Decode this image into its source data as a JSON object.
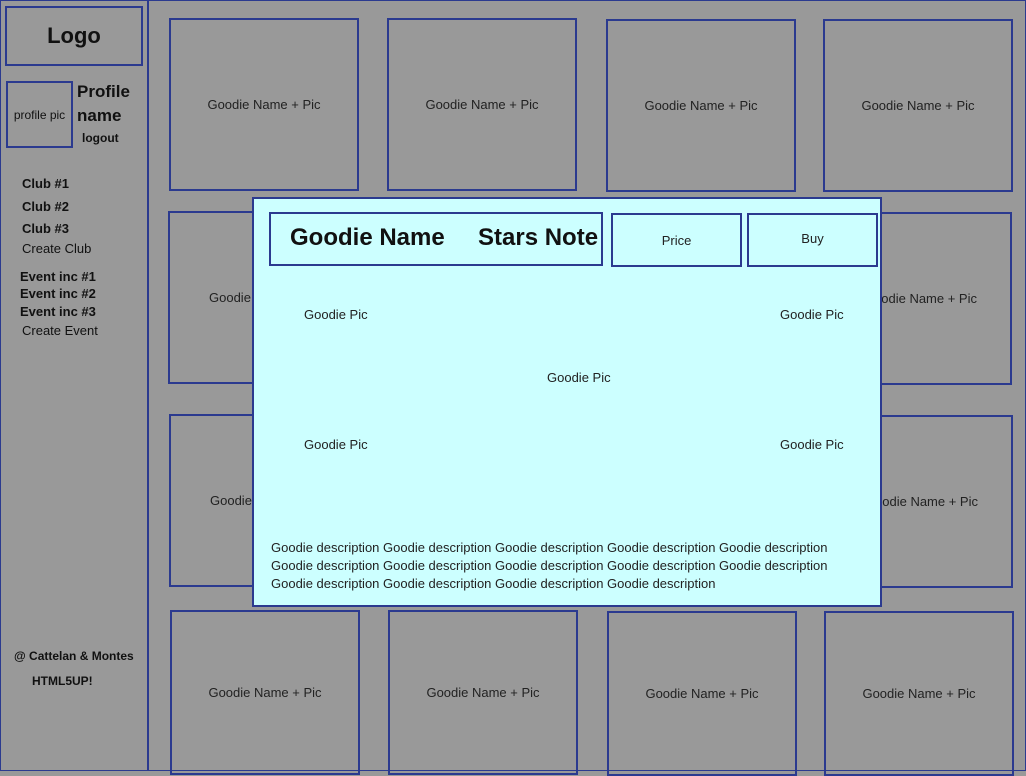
{
  "sidebar": {
    "logo": "Logo",
    "profile_pic": "profile pic",
    "profile_name": "Profile name",
    "logout": "logout",
    "clubs": [
      "Club #1",
      "Club #2",
      "Club #3"
    ],
    "create_club": "Create Club",
    "events": [
      "Event inc #1",
      "Event inc #2",
      "Event inc #3"
    ],
    "create_event": "Create Event",
    "footer": [
      "@ Cattelan & Montes",
      "HTML5UP!"
    ]
  },
  "grid": {
    "card_label": "Goodie Name + Pic",
    "partial_left_label": "Goodie",
    "partial_right_label": "odie Name + Pic"
  },
  "modal": {
    "title": "Goodie Name",
    "stars": "Stars Note",
    "price_label": "Price",
    "buy_label": "Buy",
    "pic_label": "Goodie Pic",
    "description": "Goodie description Goodie description Goodie description Goodie description Goodie description Goodie description Goodie description Goodie description Goodie description Goodie description Goodie description Goodie description Goodie description Goodie description"
  },
  "colors": {
    "background": "#999999",
    "border": "#2b3a8f",
    "modal_bg": "#ccffff"
  }
}
